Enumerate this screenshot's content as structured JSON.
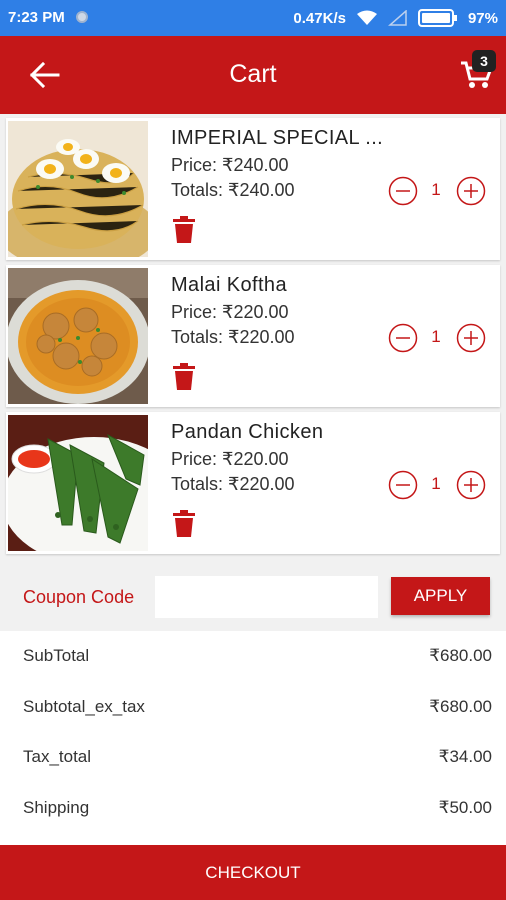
{
  "status_bar": {
    "time": "7:23 PM",
    "network_speed": "0.47K/s",
    "battery": "97%"
  },
  "header": {
    "title": "Cart",
    "cart_count": "3"
  },
  "items": [
    {
      "name": "IMPERIAL SPECIAL ...",
      "price": "Price: ₹240.00",
      "totals": "Totals: ₹240.00",
      "qty": "1"
    },
    {
      "name": "Malai Koftha",
      "price": "Price: ₹220.00",
      "totals": "Totals: ₹220.00",
      "qty": "1"
    },
    {
      "name": "Pandan Chicken",
      "price": "Price: ₹220.00",
      "totals": "Totals: ₹220.00",
      "qty": "1"
    }
  ],
  "coupon": {
    "label": "Coupon Code",
    "value": "",
    "apply_label": "APPLY"
  },
  "summary": [
    {
      "label": "SubTotal",
      "value": "₹680.00"
    },
    {
      "label": "Subtotal_ex_tax",
      "value": "₹680.00"
    },
    {
      "label": "Tax_total",
      "value": "₹34.00"
    },
    {
      "label": "Shipping",
      "value": "₹50.00"
    }
  ],
  "checkout_label": "CHECKOUT",
  "colors": {
    "brand": "#c41718",
    "status_bar": "#2f7fe6"
  },
  "icons": [
    "back-arrow-icon",
    "cart-icon",
    "trash-icon",
    "minus-circle-icon",
    "plus-circle-icon",
    "wifi-icon",
    "signal-icon",
    "battery-icon"
  ]
}
